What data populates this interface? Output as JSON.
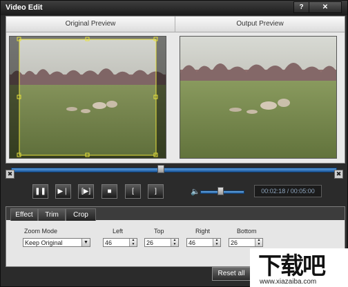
{
  "window": {
    "title": "Video Edit",
    "help_label": "?",
    "close_label": "✕"
  },
  "preview": {
    "original_label": "Original Preview",
    "output_label": "Output Preview"
  },
  "timeline": {
    "start_marker": "✖",
    "end_marker": "✖",
    "position_fraction": 0.46
  },
  "controls": {
    "play_pause_icon": "❚❚",
    "next_frame_icon": "▶❘",
    "step_icon": "[▶]",
    "stop_icon": "■",
    "mark_in_icon": "[",
    "mark_out_icon": "]",
    "volume_icon": "🔈",
    "volume_fraction": 0.45,
    "timecode": "00:02:18 / 00:05:00"
  },
  "tabs": [
    {
      "label": "Effect"
    },
    {
      "label": "Trim"
    },
    {
      "label": "Crop",
      "active": true
    }
  ],
  "crop": {
    "zoom_mode_label": "Zoom Mode",
    "zoom_mode_value": "Keep Original",
    "left_label": "Left",
    "left_value": "46",
    "top_label": "Top",
    "top_value": "26",
    "right_label": "Right",
    "right_value": "46",
    "bottom_label": "Bottom",
    "bottom_value": "26"
  },
  "buttons": {
    "reset_all": "Reset all"
  },
  "watermark": {
    "text": "下载吧",
    "url": "www.xiazaiba.com"
  },
  "colors": {
    "accent": "#2a6fc0",
    "window_bg": "#2b2b2b",
    "panel_bg": "#e6e6e6"
  }
}
